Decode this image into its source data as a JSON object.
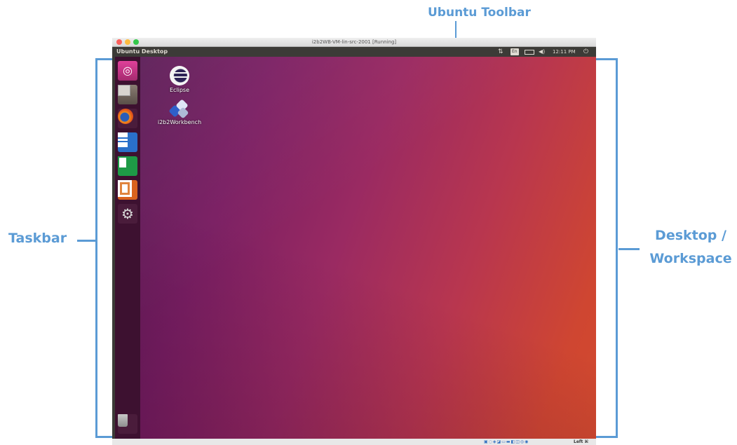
{
  "annotations": {
    "toolbar": "Ubuntu Toolbar",
    "taskbar": "Taskbar",
    "desktop_line1": "Desktop /",
    "desktop_line2": "Workspace"
  },
  "vm_window": {
    "title": "i2b2WB-VM-lin-src-2001 [Running]"
  },
  "top_panel": {
    "app_name": "Ubuntu Desktop",
    "keyboard": "En",
    "time": "12:11 PM"
  },
  "launcher": {
    "items": [
      {
        "name": "Ubuntu Dash",
        "icon": "ubuntu-icon"
      },
      {
        "name": "Files",
        "icon": "files-icon"
      },
      {
        "name": "Firefox",
        "icon": "firefox-icon"
      },
      {
        "name": "LibreOffice Writer",
        "icon": "writer-icon"
      },
      {
        "name": "LibreOffice Calc",
        "icon": "calc-icon"
      },
      {
        "name": "LibreOffice Impress",
        "icon": "impress-icon"
      },
      {
        "name": "System Settings",
        "icon": "settings-icon"
      }
    ],
    "trash": "trash-icon"
  },
  "desktop_icons": [
    {
      "label": "Eclipse",
      "icon": "eclipse-icon"
    },
    {
      "label": "i2b2Workbench",
      "icon": "workbench-icon"
    }
  ],
  "status_bar": {
    "host_key": "Left ⌘"
  }
}
